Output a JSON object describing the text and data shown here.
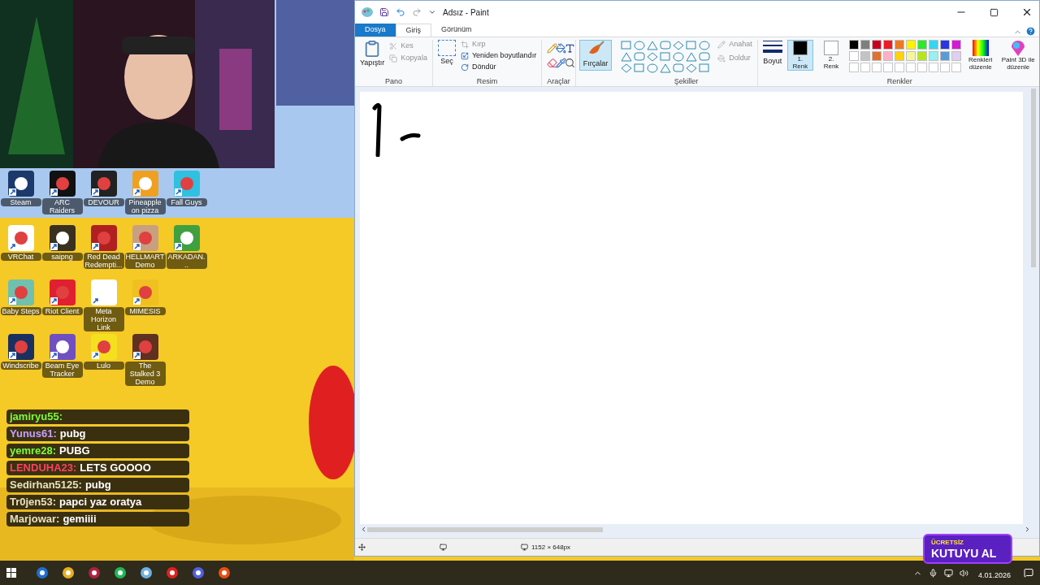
{
  "desktop": {
    "rows": [
      [
        {
          "label": "Steam"
        },
        {
          "label": "ARC Raiders"
        },
        {
          "label": "DEVOUR"
        },
        {
          "label": "Pineapple on pizza"
        },
        {
          "label": "Fall Guys"
        }
      ],
      [
        {
          "label": "VRChat"
        },
        {
          "label": "saipng"
        },
        {
          "label": "Red Dead Redempti..."
        },
        {
          "label": "HELLMART Demo"
        },
        {
          "label": "ARKADAN..."
        }
      ],
      [
        {
          "label": "Baby Steps"
        },
        {
          "label": "Riot Client"
        },
        {
          "label": "Meta Horizon Link"
        },
        {
          "label": "MIMESIS"
        }
      ],
      [
        {
          "label": "Windscribe"
        },
        {
          "label": "Beam Eye Tracker"
        },
        {
          "label": "Lulo"
        },
        {
          "label": "The Stalked 3 Demo"
        }
      ]
    ]
  },
  "chat": [
    {
      "user": "jamiryu55:"
    },
    {
      "user": "Yunus61:",
      "message": "pubg"
    },
    {
      "user": "yemre28:",
      "message": "PUBG"
    },
    {
      "user": "LENDUHA23:",
      "message": "LETS GOOOO"
    },
    {
      "user": "Sedirhan5125:",
      "message": "pubg"
    },
    {
      "user": "Tr0jen53:",
      "message": "papci yaz oratya"
    },
    {
      "user": "Marjowar:",
      "message": "gemiiii"
    }
  ],
  "paint": {
    "title": "Adsız - Paint",
    "tabs": [
      {
        "label": "Dosya",
        "kind": "file",
        "selected": false
      },
      {
        "label": "Giriş",
        "kind": "tab",
        "selected": true
      },
      {
        "label": "Görünüm",
        "kind": "tab",
        "selected": false
      }
    ],
    "clipboard": {
      "paste": "Yapıştır",
      "cut": {
        "label": "Kes",
        "disabled": true
      },
      "copy": {
        "label": "Kopyala",
        "disabled": true
      },
      "group": "Pano"
    },
    "image": {
      "select": "Seç",
      "crop": {
        "label": "Kırp",
        "disabled": true
      },
      "resize": "Yeniden boyutlandır",
      "rotate": "Döndür",
      "group": "Resim"
    },
    "tools": {
      "group": "Araçlar"
    },
    "brushes": {
      "label": "Fırçalar",
      "selected": true
    },
    "shapes": {
      "outline": {
        "label": "Anahat",
        "disabled": true
      },
      "fill": {
        "label": "Doldur",
        "disabled": true
      },
      "group": "Şekiller"
    },
    "size": "Boyut",
    "color1": {
      "label": "1.",
      "sub": "Renk",
      "color": "#000000",
      "selected": true
    },
    "color2": {
      "label": "2.",
      "sub": "Renk",
      "color": "#ffffff",
      "selected": false
    },
    "palette": [
      {
        "color": "#000000"
      },
      {
        "color": "#7f7f7f"
      },
      {
        "color": "#c8001e"
      },
      {
        "color": "#ed1c24"
      },
      {
        "color": "#f07820"
      },
      {
        "color": "#fff200"
      },
      {
        "color": "#2de82d"
      },
      {
        "color": "#33d6f0"
      },
      {
        "color": "#2b35e0"
      },
      {
        "color": "#d51ad5"
      },
      {
        "color": "#ffffff"
      },
      {
        "color": "#c3c3c3"
      },
      {
        "color": "#e07030"
      },
      {
        "color": "#ffaec9"
      },
      {
        "color": "#ffd20e"
      },
      {
        "color": "#f5f5a0"
      },
      {
        "color": "#b5e61d"
      },
      {
        "color": "#99f0f0"
      },
      {
        "color": "#5b9bd5"
      },
      {
        "color": "#e0cff0"
      }
    ],
    "colors_group": "Renkler",
    "edit_colors": "Renkleri düzenle",
    "paint3d": "Paint 3D ile düzenle",
    "status_size": "1152 × 648px"
  },
  "ad": {
    "line1": "ÜCRETSİZ",
    "line2": "KUTUYU AL"
  },
  "taskbar": {
    "date": "4.01.2026"
  }
}
